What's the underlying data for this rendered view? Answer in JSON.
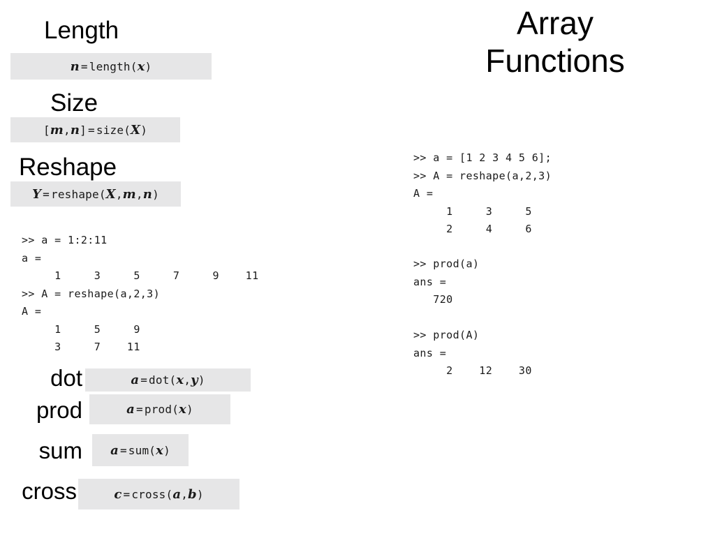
{
  "slide": {
    "title_lines": [
      "Array",
      "Functions"
    ],
    "background_color": "#ffffff",
    "plate_color": "#e6e6e7",
    "text_color": "#000000"
  },
  "sections": [
    {
      "label": "Length",
      "equation": {
        "lhs": "n",
        "eq": "=",
        "fn": "length(",
        "args": "x",
        "close": ")",
        "plain": "n = length(x)"
      }
    },
    {
      "label": "Size",
      "equation": {
        "lhs_open": "[",
        "lhs_a": "m",
        "comma": ",",
        "lhs_b": "n",
        "lhs_close": "]",
        "eq": "=",
        "fn": "size(",
        "args": "X",
        "close": ")",
        "plain": "[m,n] = size(X)"
      }
    },
    {
      "label": "Reshape",
      "equation": {
        "lhs": "Y",
        "eq": "=",
        "fn": "reshape(",
        "arg1": "X",
        "comma1": ",",
        "arg2": "m",
        "comma2": ",",
        "arg3": "n",
        "close": ")",
        "plain": "Y = reshape(X,m,n)"
      }
    }
  ],
  "left_console": {
    "lines": [
      ">> a = 1:2:11",
      "a =",
      "     1     3     5     7     9    11",
      ">> A = reshape(a,2,3)",
      "A =",
      "     1     5     9",
      "     3     7    11"
    ],
    "commands": [
      ">> a = 1:2:11",
      ">> A = reshape(a,2,3)"
    ],
    "vector_a": [
      1,
      3,
      5,
      7,
      9,
      11
    ],
    "matrix_A": [
      [
        1,
        5,
        9
      ],
      [
        3,
        7,
        11
      ]
    ]
  },
  "right_console": {
    "block1": [
      ">> a = [1 2 3 4 5 6];",
      ">> A = reshape(a,2,3)",
      "A =",
      "     1     3     5",
      "     2     4     6"
    ],
    "block2": [
      ">> prod(a)",
      "ans =",
      "   720"
    ],
    "block3": [
      ">> prod(A)",
      "ans =",
      "     2    12    30"
    ],
    "vector_a": [
      1,
      2,
      3,
      4,
      5,
      6
    ],
    "matrix_A": [
      [
        1,
        3,
        5
      ],
      [
        2,
        4,
        6
      ]
    ],
    "prod_a": 720,
    "prod_A": [
      2,
      12,
      30
    ]
  },
  "function_rows": [
    {
      "label": "dot",
      "equation": {
        "lhs": "a",
        "eq": "=",
        "fn": "dot(",
        "arg1": "x",
        "comma": ",",
        "arg2": "y",
        "close": ")",
        "plain": "a = dot(x,y)"
      }
    },
    {
      "label": "prod",
      "equation": {
        "lhs": "a",
        "eq": "=",
        "fn": "prod(",
        "arg1": "x",
        "close": ")",
        "plain": "a = prod(x)"
      }
    },
    {
      "label": "sum",
      "equation": {
        "lhs": "a",
        "eq": "=",
        "fn": "sum(",
        "arg1": "x",
        "close": ")",
        "plain": "a = sum(x)"
      }
    },
    {
      "label": "cross",
      "equation": {
        "lhs": "c",
        "eq": "=",
        "fn": "cross(",
        "arg1": "a",
        "comma": ",",
        "arg2": "b",
        "close": ")",
        "plain": "c = cross(a,b)"
      }
    }
  ]
}
